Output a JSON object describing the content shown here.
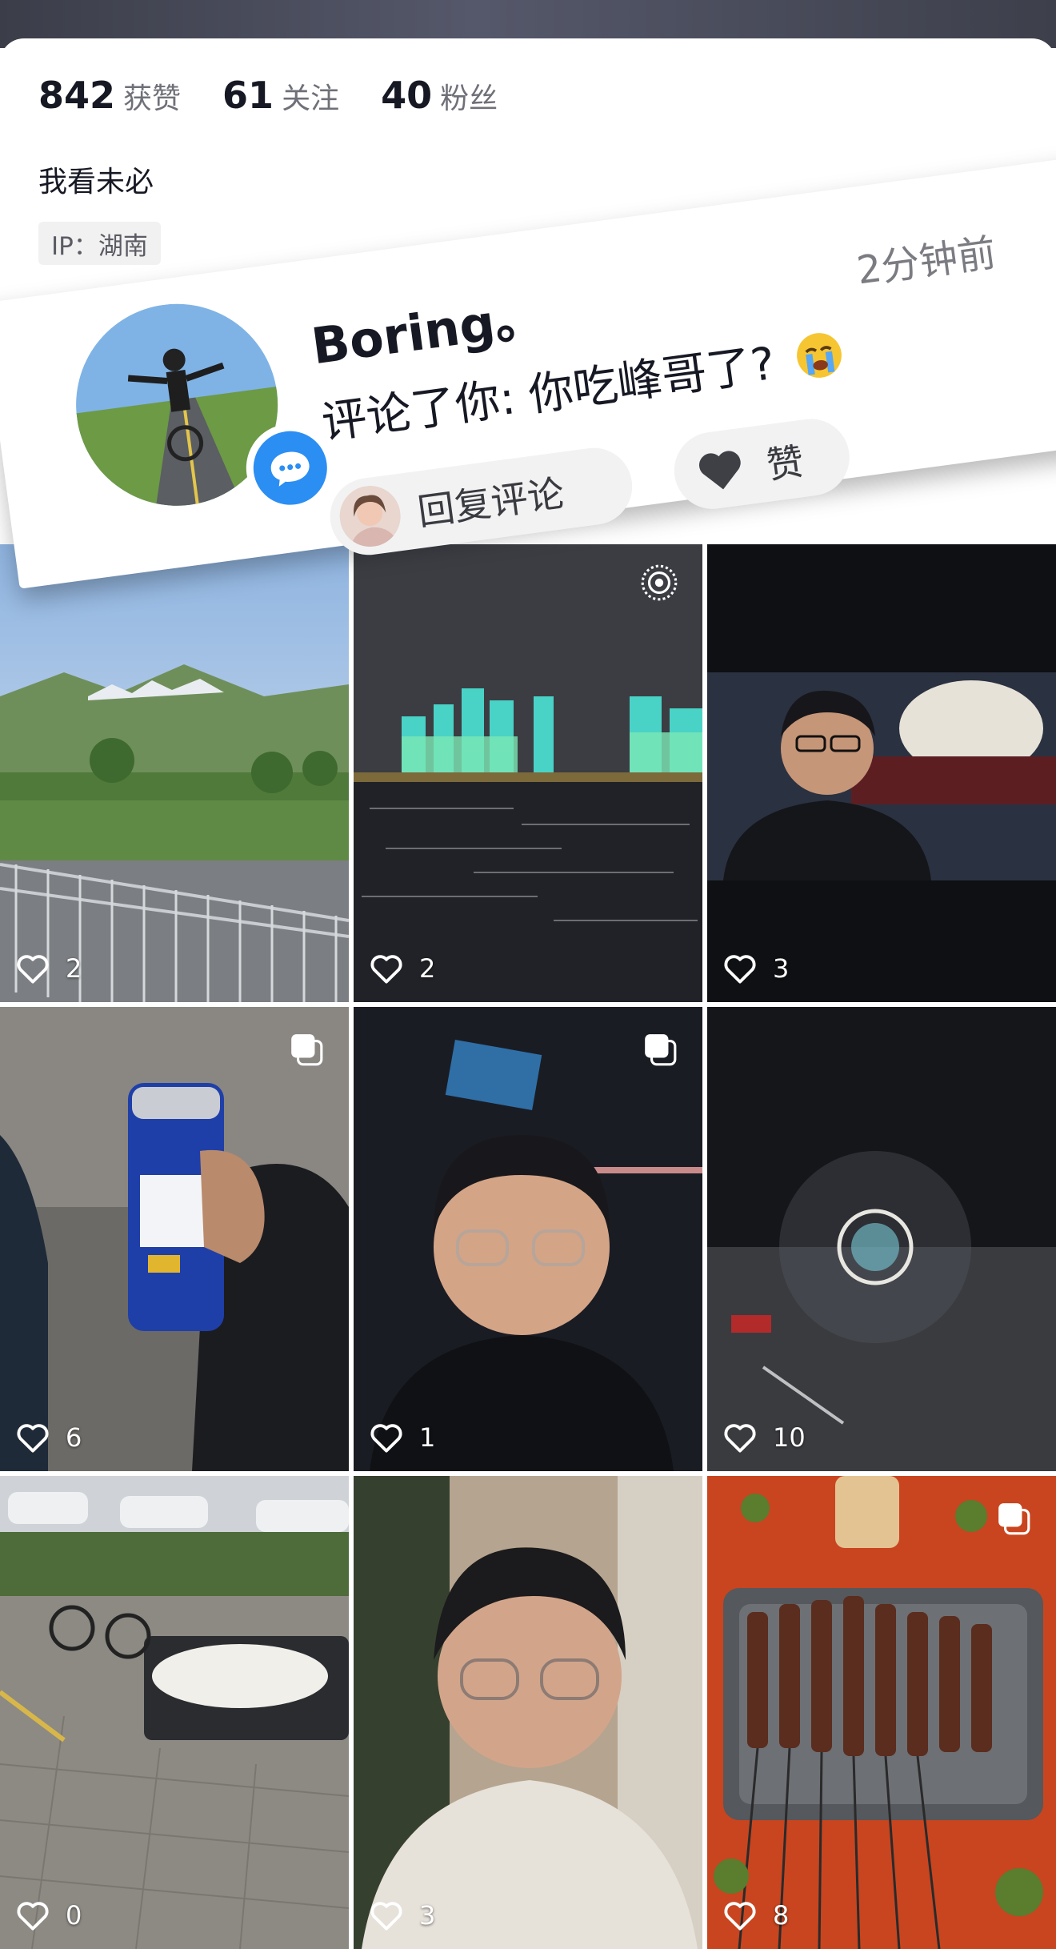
{
  "profile": {
    "stats": [
      {
        "value": "842",
        "label": "获赞"
      },
      {
        "value": "61",
        "label": "关注"
      },
      {
        "value": "40",
        "label": "粉丝"
      }
    ],
    "bio": "我看未必",
    "ip": "IP：湖南"
  },
  "notification": {
    "username": "Boring。",
    "time": "2分钟前",
    "comment": "评论了你: 你吃峰哥了?",
    "reply_label": "回复评论",
    "like_label": "赞"
  },
  "grid": {
    "posts": [
      {
        "likes": "2",
        "scene": "grassland-fence"
      },
      {
        "likes": "2",
        "scene": "night-river-city"
      },
      {
        "likes": "3",
        "scene": "night-selfie-statue"
      },
      {
        "likes": "6",
        "scene": "beer-can"
      },
      {
        "likes": "1",
        "scene": "selfie-bar"
      },
      {
        "likes": "10",
        "scene": "night-ferris-wheel"
      },
      {
        "likes": "0",
        "scene": "parking-lot-plush"
      },
      {
        "likes": "3",
        "scene": "selfie-indoor"
      },
      {
        "likes": "8",
        "scene": "bbq-skewers"
      }
    ]
  },
  "icons": {
    "like": "heart-outline-icon",
    "multi": "multi-image-icon",
    "live": "live-photo-icon",
    "message": "message-bubble-icon"
  },
  "colors": {
    "accent_blue": "#2b8ef3",
    "text_primary": "#161823",
    "text_secondary": "#6f7078"
  }
}
